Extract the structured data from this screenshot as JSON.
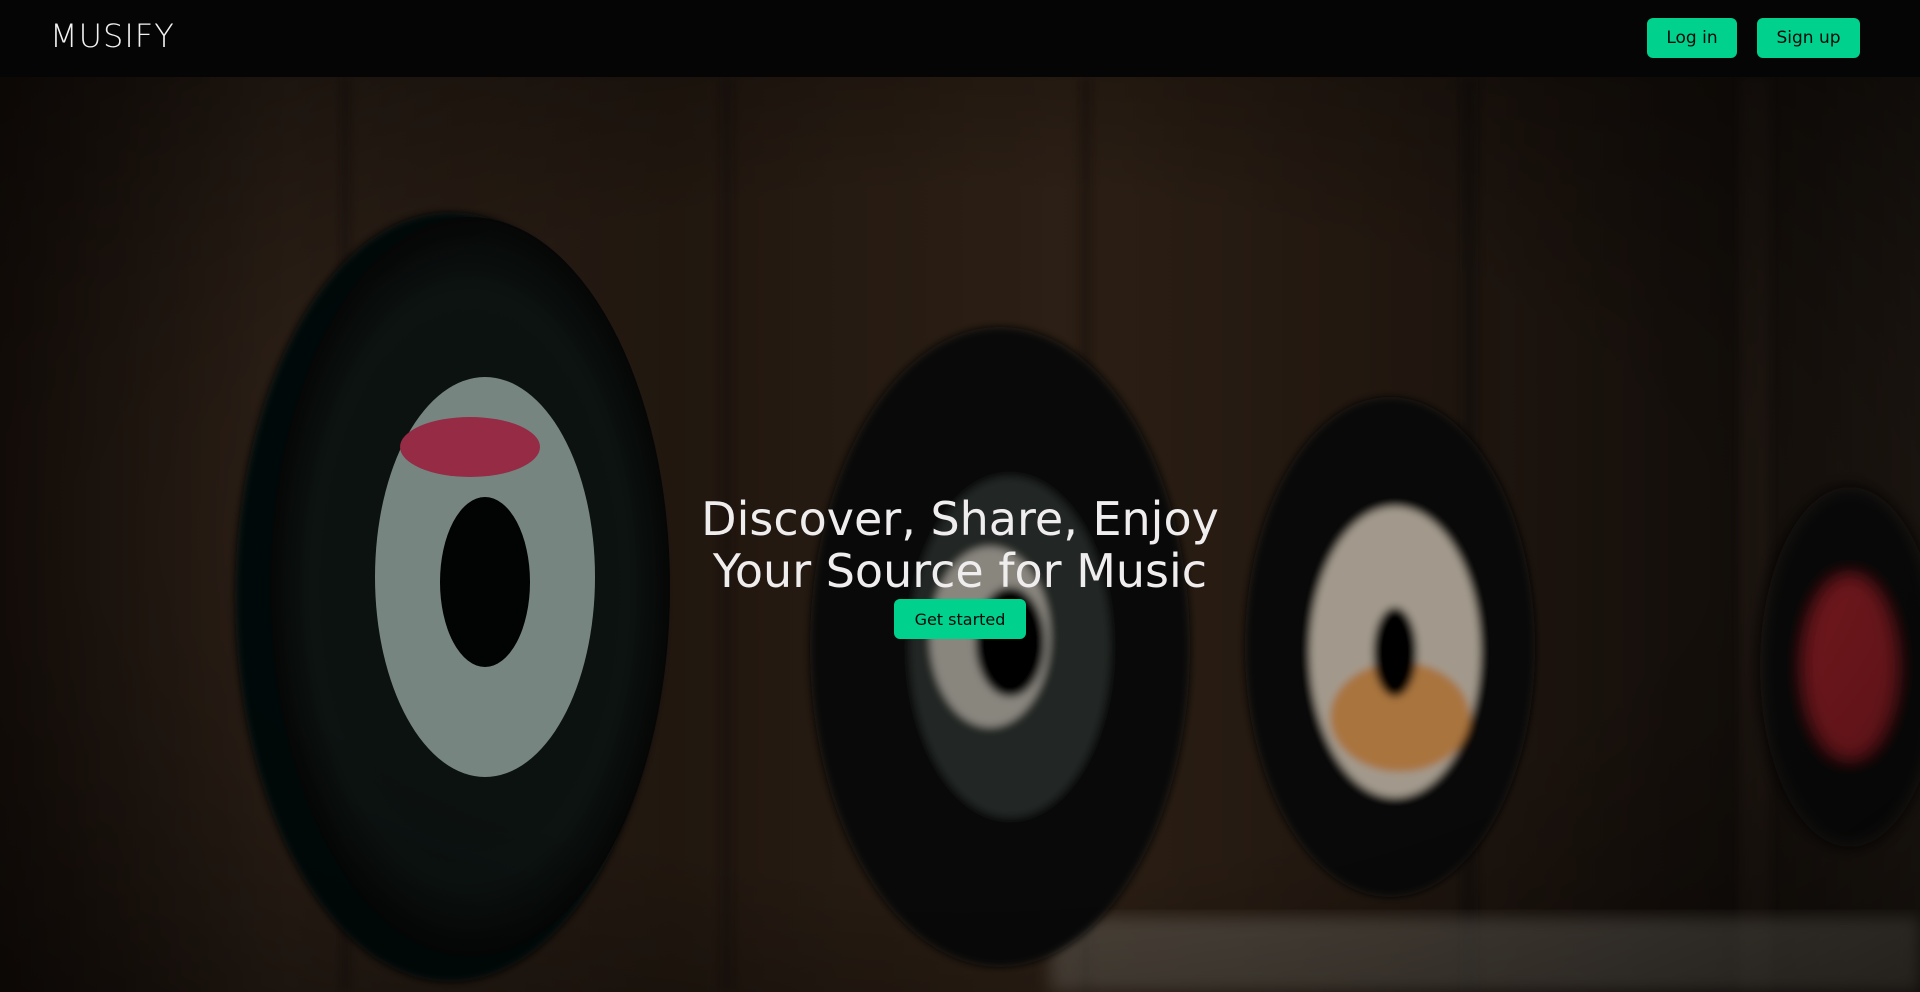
{
  "navbar": {
    "brand": "MUSIFY",
    "login_label": "Log in",
    "signup_label": "Sign up"
  },
  "hero": {
    "title_line1": "Discover, Share, Enjoy",
    "title_line2": "Your Source for Music",
    "cta_label": "Get started",
    "background": "vinyl-records-on-wooden-wall-photo"
  },
  "colors": {
    "accent": "#00d18c",
    "nav_background": "#050505",
    "text_light": "#efeded"
  }
}
